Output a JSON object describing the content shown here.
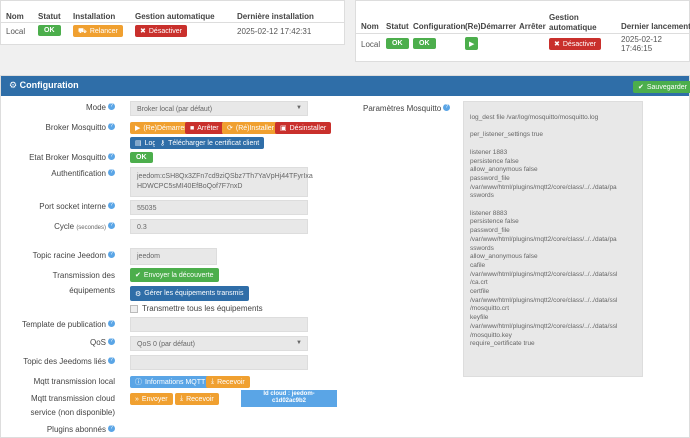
{
  "top_left": {
    "headers": [
      "Nom",
      "Statut",
      "Installation",
      "Gestion automatique",
      "Dernière installation"
    ],
    "row": {
      "name": "Local",
      "status": "OK",
      "install_btn": "Relancer",
      "auto_btn": "Désactiver",
      "last_install": "2025-02-12 17:42:31"
    }
  },
  "top_right": {
    "headers": [
      "Nom",
      "Statut",
      "Configuration",
      "(Re)Démarrer",
      "Arrêter",
      "Gestion automatique",
      "Dernier lancement"
    ],
    "row": {
      "name": "Local",
      "status": "OK",
      "config": "OK",
      "auto_btn": "Désactiver",
      "last_launch": "2025-02-12 17:46:15"
    }
  },
  "config": {
    "title": "Configuration",
    "save_label": "Sauvegarder",
    "labels": {
      "mode": "Mode",
      "broker": "Broker Mosquitto",
      "etat": "Etat Broker Mosquitto",
      "auth": "Authentification",
      "port": "Port socket interne",
      "cycle": "Cycle",
      "cycle_unit": "(secondes)",
      "topic_root": "Topic racine Jeedom",
      "transmission_1": "Transmission des",
      "transmission_2": "équipements",
      "template": "Template de publication",
      "qos": "QoS",
      "topic_linked": "Topic des Jeedoms liés",
      "mqtt_local": "Mqtt transmission local",
      "mqtt_cloud_1": "Mqtt transmission cloud",
      "mqtt_cloud_2": "service (non disponible)",
      "plugins": "Plugins abonnés"
    },
    "mode_value": "Broker local (par défaut)",
    "broker_buttons": {
      "restart": "(Re)Démarrer",
      "stop": "Arrêter",
      "reinstall": "(Ré)Installer",
      "uninstall": "Désinstaller",
      "log": "Log",
      "cert": "Télécharger le certificat client"
    },
    "etat_value": "OK",
    "auth_line1": "jeedom:cSH8Qx3ZFn7cd9ziQSbz7Th7YaVpHj44TFyrIxa",
    "auth_line2": "HDWCPC5sMI40EfBoQof7F7nxD",
    "port_value": "55035",
    "cycle_value": "0.3",
    "topic_root_value": "jeedom",
    "send_discovery": "Envoyer la découverte",
    "manage_transmitted": "Gérer les équipements transmis",
    "transmit_all": "Transmettre tous les équipements",
    "qos_value": "QoS 0 (par défaut)",
    "info_mqtt": "Informations MQTT",
    "receive": "Recevoir",
    "send": "Envoyer",
    "receive2": "Recevoir",
    "cloud_id_1": "Id cloud : jeedom-",
    "cloud_id_2": "c1d02ac9b2",
    "params_label": "Paramètres Mosquitto",
    "params_text": "log_dest file /var/log/mosquitto/mosquitto.log\n\nper_listener_settings true\n\nlistener 1883\npersistence false\nallow_anonymous false\npassword_file\n/var/www/html/plugins/mqtt2/core/class/../../data/pa\nsswords\n\nlistener 8883\npersistence false\npassword_file\n/var/www/html/plugins/mqtt2/core/class/../../data/pa\nsswords\nallow_anonymous false\ncafile\n/var/www/html/plugins/mqtt2/core/class/../../data/ssl\n/ca.crt\ncertfile\n/var/www/html/plugins/mqtt2/core/class/../../data/ssl\n/mosquitto.crt\nkeyfile\n/var/www/html/plugins/mqtt2/core/class/../../data/ssl\n/mosquitto.key\nrequire_certificate true"
  }
}
